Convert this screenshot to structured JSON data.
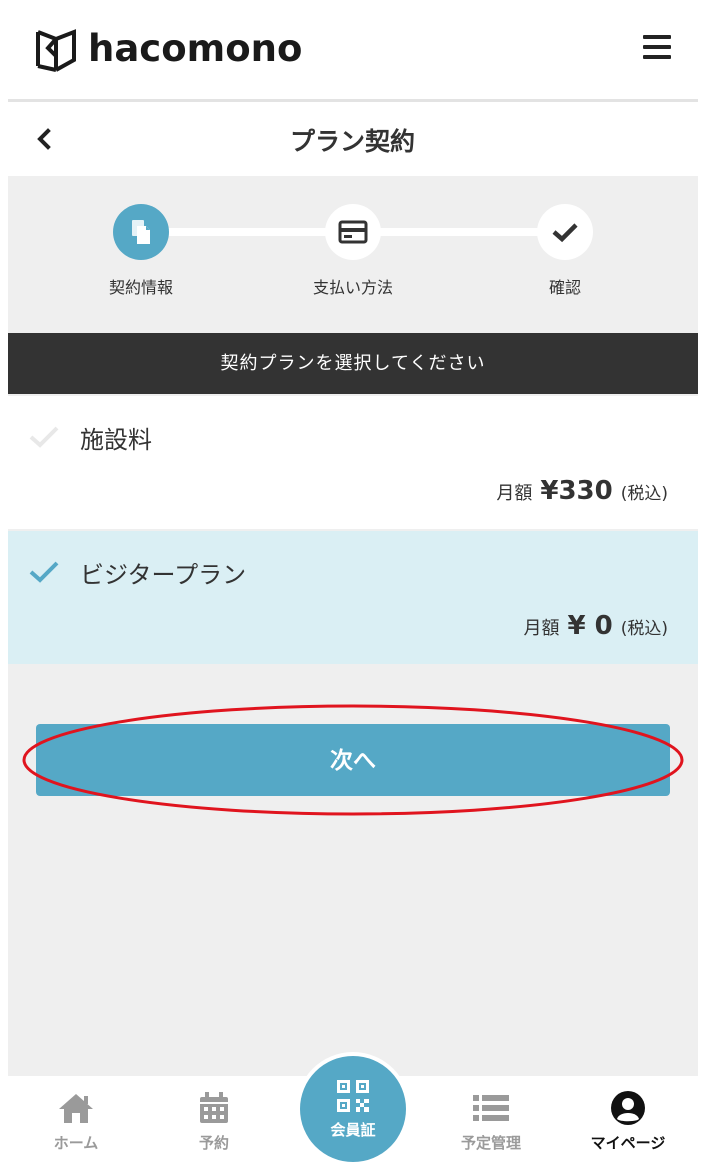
{
  "header": {
    "logo_text": "hacomono",
    "menu_icon": "hamburger-menu-icon"
  },
  "titlebar": {
    "back_icon": "chevron-left-icon",
    "title": "プラン契約"
  },
  "stepper": {
    "steps": [
      {
        "label": "契約情報",
        "icon": "documents-icon",
        "state": "active"
      },
      {
        "label": "支払い方法",
        "icon": "credit-card-icon",
        "state": "pending"
      },
      {
        "label": "確認",
        "icon": "checkmark-icon",
        "state": "pending"
      }
    ]
  },
  "instruction": "契約プランを選択してください",
  "plans": [
    {
      "name": "施設料",
      "unit": "月額",
      "amount": "¥330",
      "tax": "(税込)",
      "selected": false
    },
    {
      "name": "ビジタープラン",
      "unit": "月額",
      "amount": "¥ 0",
      "tax": "(税込)",
      "selected": true
    }
  ],
  "next_button": {
    "label": "次へ"
  },
  "bottom_nav": {
    "items": [
      {
        "label": "ホーム",
        "icon": "home-icon"
      },
      {
        "label": "予約",
        "icon": "calendar-icon"
      },
      {
        "label": "会員証",
        "icon": "qr-code-icon"
      },
      {
        "label": "予定管理",
        "icon": "list-icon"
      },
      {
        "label": "マイページ",
        "icon": "user-circle-icon",
        "active": true
      }
    ]
  },
  "colors": {
    "accent": "#55a8c6",
    "selected_row": "#daeff4",
    "instruction_bar": "#333333",
    "background_gray": "#efefef",
    "annotation": "#e0141e"
  }
}
